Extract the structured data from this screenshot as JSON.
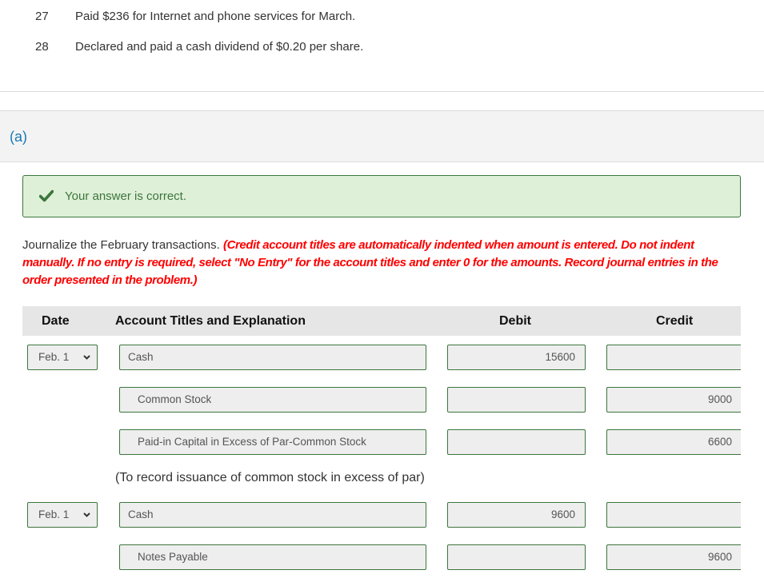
{
  "transactions": [
    {
      "day": "27",
      "text": "Paid $236 for Internet and phone services for March."
    },
    {
      "day": "28",
      "text": "Declared and paid a cash dividend of $0.20 per share."
    }
  ],
  "part": {
    "label": "(a)"
  },
  "feedback": {
    "icon": "check-icon",
    "text": "Your answer is correct.",
    "color": "#3c763d",
    "background": "#dff0d8"
  },
  "instructions": {
    "lead": "Journalize the February transactions. ",
    "note": "(Credit account titles are automatically indented when amount is entered. Do not indent manually. If no entry is required, select \"No Entry\" for the account titles and enter 0 for the amounts. Record journal entries in the order presented in the problem.)",
    "note_color": "#ff0000"
  },
  "table": {
    "headers": {
      "date": "Date",
      "account": "Account Titles and Explanation",
      "debit": "Debit",
      "credit": "Credit"
    },
    "entries": [
      {
        "date": "Feb. 1",
        "lines": [
          {
            "account": "Cash",
            "debit": "15600",
            "credit": ""
          },
          {
            "account": "Common Stock",
            "debit": "",
            "credit": "9000"
          },
          {
            "account": "Paid-in Capital in Excess of Par-Common Stock",
            "debit": "",
            "credit": "6600"
          }
        ],
        "explanation": "(To record issuance of common stock in excess of par)"
      },
      {
        "date": "Feb. 1",
        "lines": [
          {
            "account": "Cash",
            "debit": "9600",
            "credit": ""
          },
          {
            "account": "Notes Payable",
            "debit": "",
            "credit": "9600"
          }
        ]
      }
    ]
  }
}
